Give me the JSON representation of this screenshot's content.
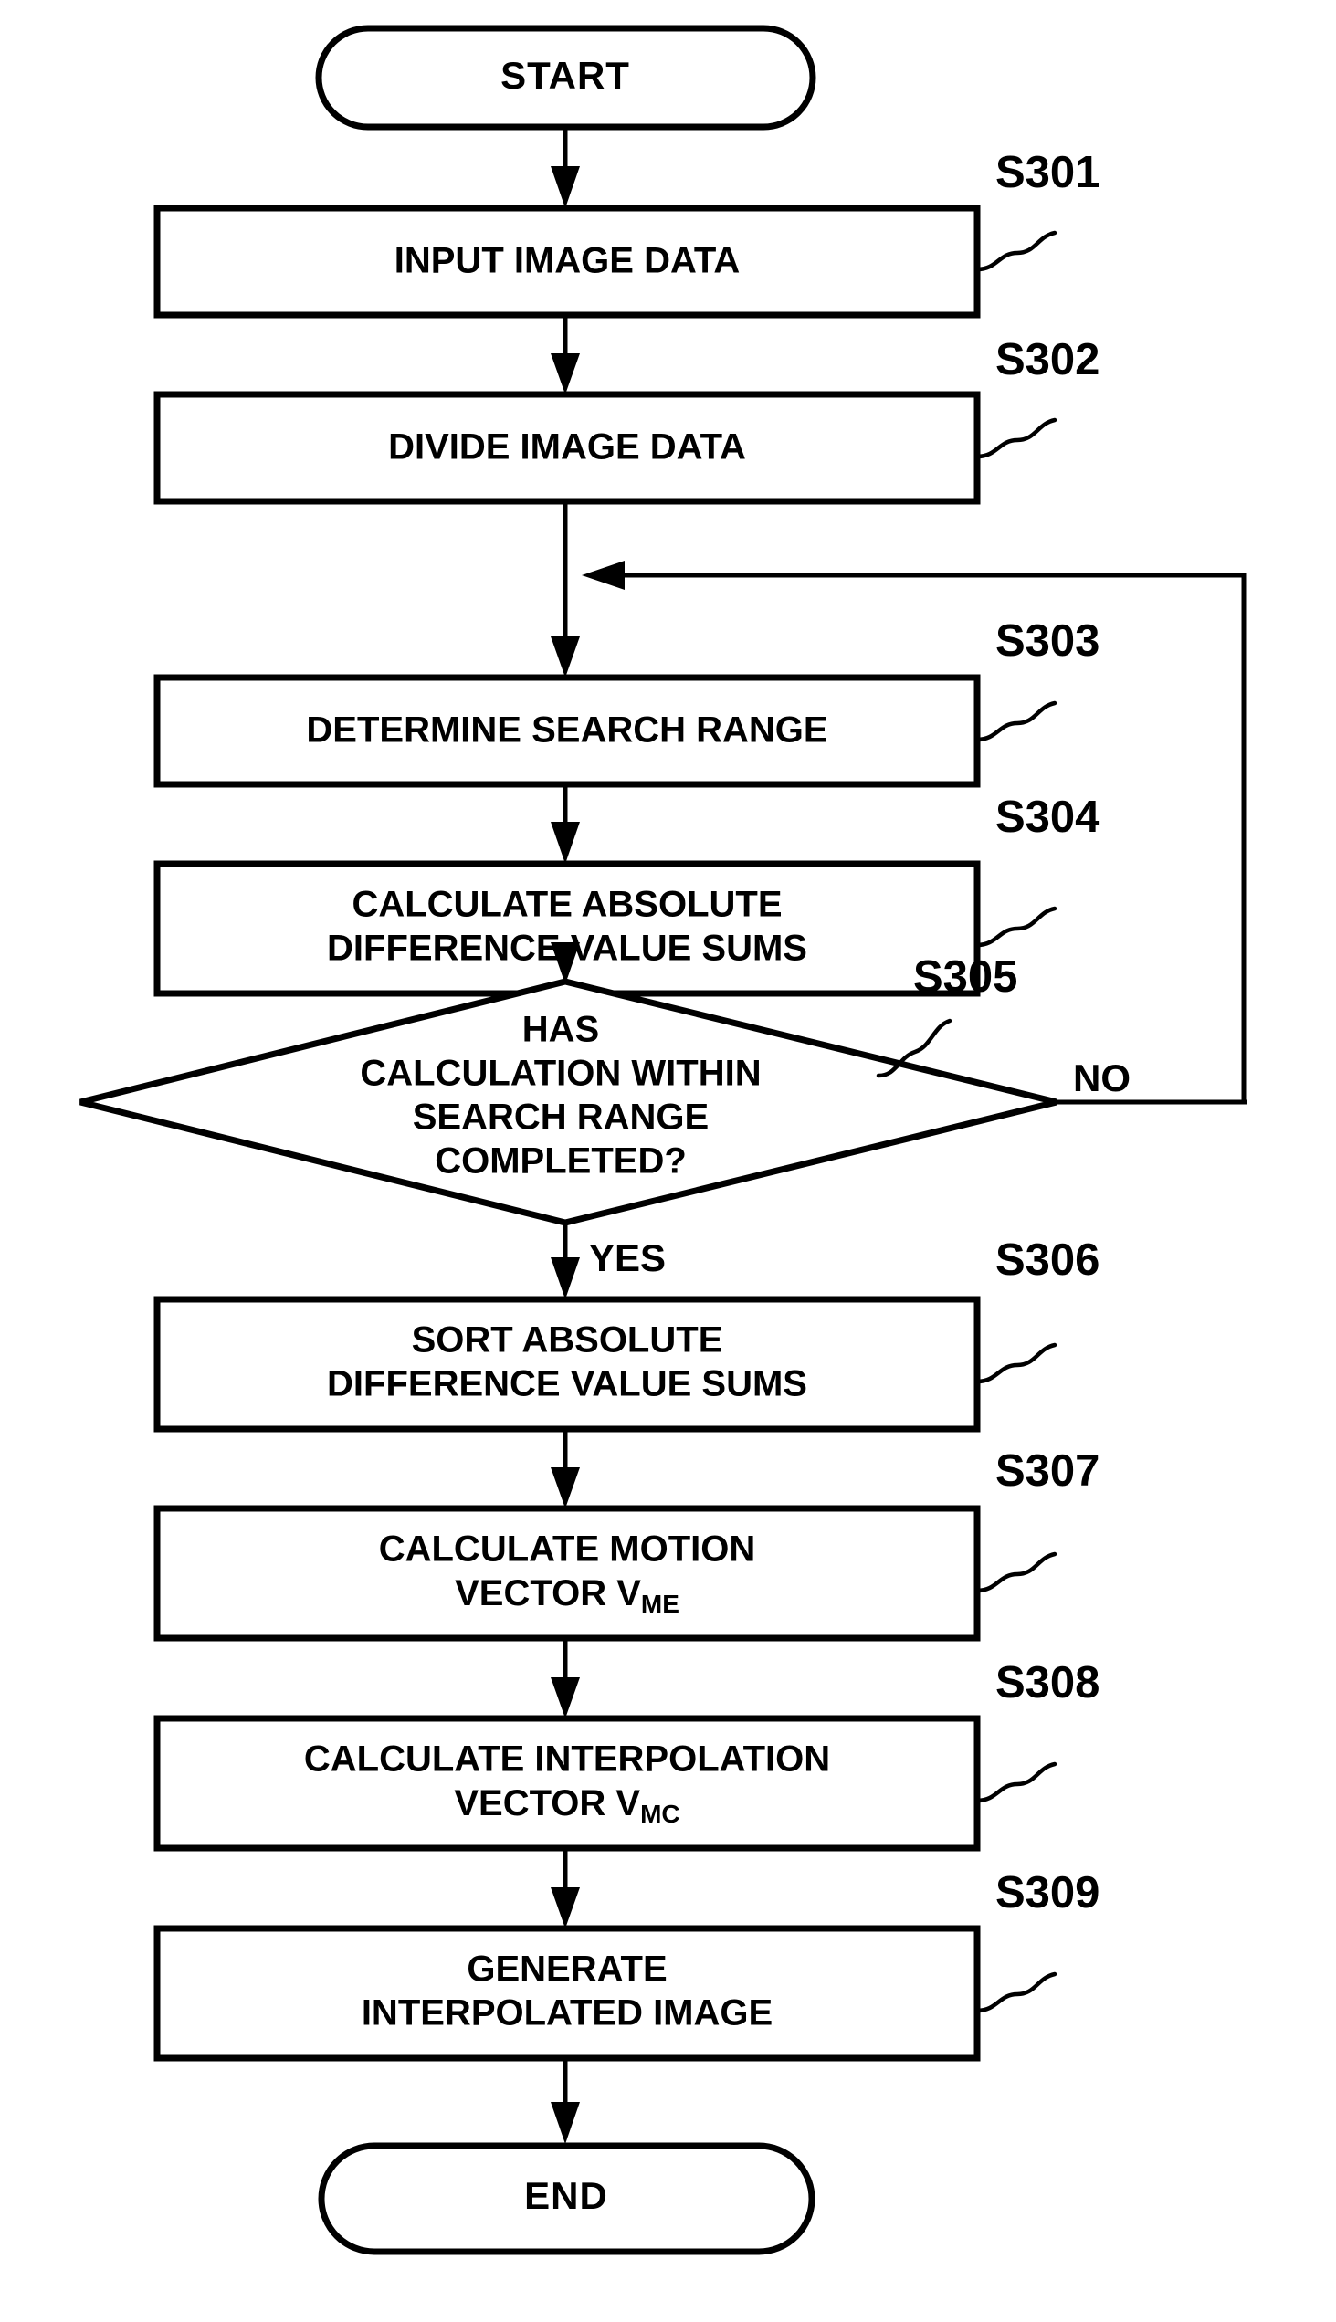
{
  "diagram": {
    "type": "flowchart",
    "title": "",
    "orientation": "vertical",
    "colors": {
      "stroke": "#000000",
      "fill": "#ffffff",
      "text": "#000000"
    }
  },
  "nodes": {
    "start": {
      "shape": "terminator",
      "label": "START"
    },
    "s301": {
      "shape": "process",
      "step": "S301",
      "line1": "INPUT IMAGE DATA",
      "line2": ""
    },
    "s302": {
      "shape": "process",
      "step": "S302",
      "line1": "DIVIDE IMAGE DATA",
      "line2": ""
    },
    "s303": {
      "shape": "process",
      "step": "S303",
      "line1": "DETERMINE SEARCH RANGE",
      "line2": ""
    },
    "s304": {
      "shape": "process",
      "step": "S304",
      "line1": "CALCULATE ABSOLUTE",
      "line2": "DIFFERENCE VALUE SUMS"
    },
    "s305": {
      "shape": "decision",
      "step": "S305",
      "line1": "HAS",
      "line2": "CALCULATION WITHIN",
      "line3": "SEARCH RANGE",
      "line4": "COMPLETED?"
    },
    "s306": {
      "shape": "process",
      "step": "S306",
      "line1": "SORT ABSOLUTE",
      "line2": "DIFFERENCE VALUE SUMS"
    },
    "s307": {
      "shape": "process",
      "step": "S307",
      "line1": "CALCULATE MOTION",
      "line2_prefix": "VECTOR V",
      "line2_sub": "ME"
    },
    "s308": {
      "shape": "process",
      "step": "S308",
      "line1": "CALCULATE INTERPOLATION",
      "line2_prefix": "VECTOR V",
      "line2_sub": "MC"
    },
    "s309": {
      "shape": "process",
      "step": "S309",
      "line1": "GENERATE",
      "line2": "INTERPOLATED IMAGE"
    },
    "end": {
      "shape": "terminator",
      "label": "END"
    }
  },
  "edges": {
    "yes_label": "YES",
    "no_label": "NO"
  }
}
